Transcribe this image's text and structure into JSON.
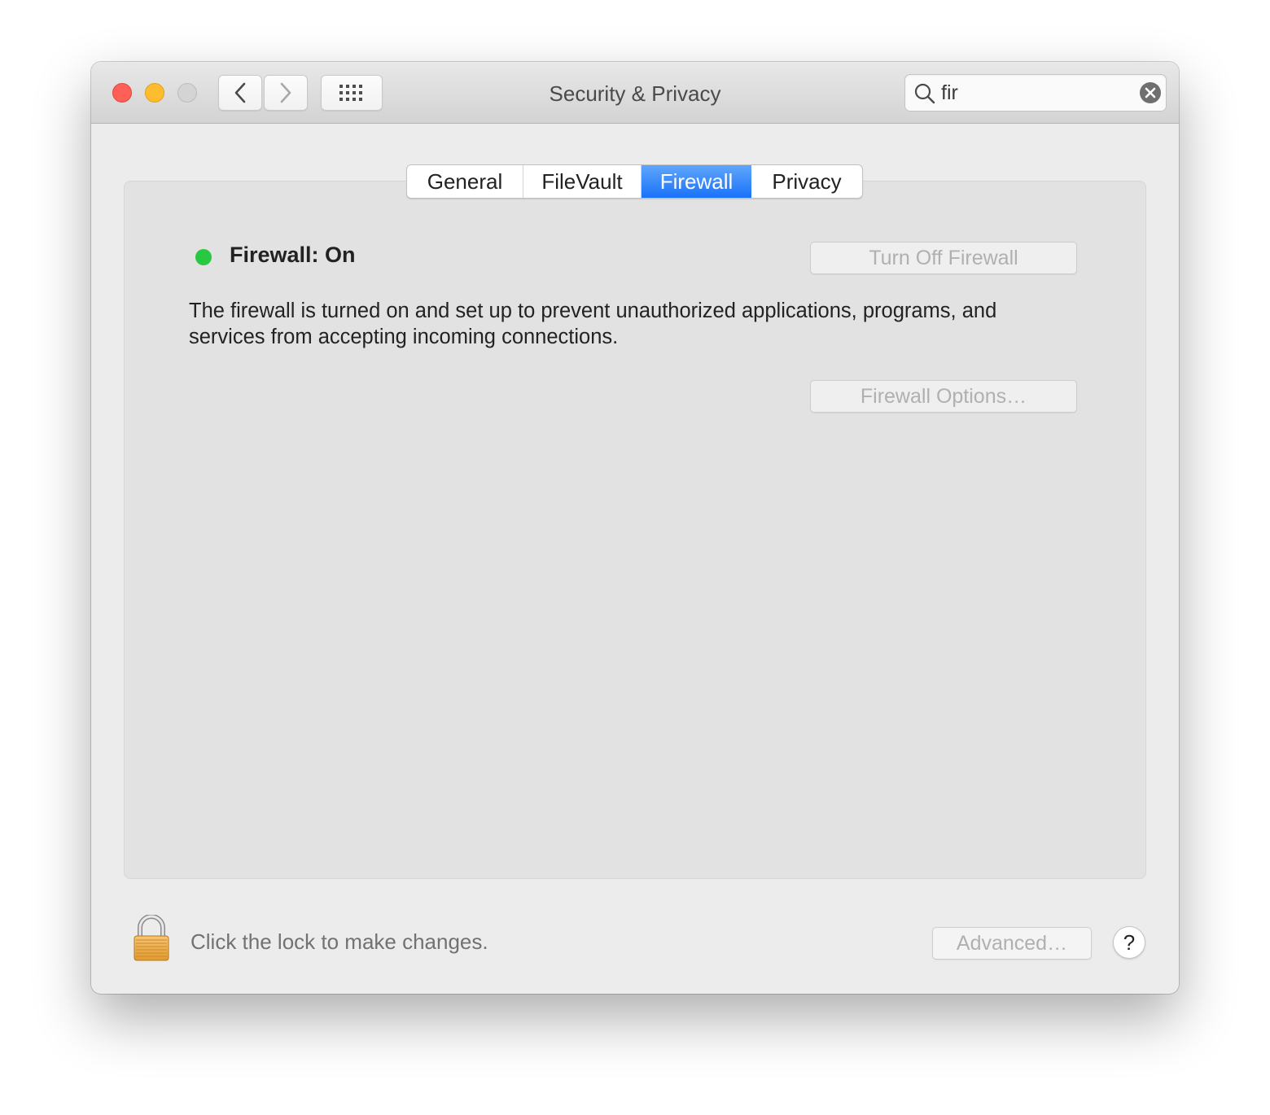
{
  "window": {
    "title": "Security & Privacy",
    "traffic_lights": [
      "close",
      "minimize",
      "zoom"
    ]
  },
  "toolbar": {
    "back_icon": "chevron-left-icon",
    "forward_icon": "chevron-right-icon",
    "show_all_icon": "grid-icon",
    "search": {
      "value": "fir",
      "placeholder": "Search",
      "icon": "search-icon",
      "clear_icon": "clear-icon"
    }
  },
  "tabs": [
    {
      "label": "General",
      "active": false
    },
    {
      "label": "FileVault",
      "active": false
    },
    {
      "label": "Firewall",
      "active": true
    },
    {
      "label": "Privacy",
      "active": false
    }
  ],
  "firewall": {
    "status_label": "Firewall: On",
    "status_color": "#28c840",
    "description": "The firewall is turned on and set up to prevent unauthorized applications, programs, and services from accepting incoming connections.",
    "turn_off_label": "Turn Off Firewall",
    "options_label": "Firewall Options…"
  },
  "footer": {
    "lock_icon": "lock-icon",
    "lock_label": "Click the lock to make changes.",
    "advanced_label": "Advanced…",
    "help_label": "?"
  },
  "colors": {
    "accent": "#1a72fa",
    "window_bg": "#ececec",
    "panel_bg": "#e2e2e2",
    "disabled_text": "#b0b0b0"
  }
}
